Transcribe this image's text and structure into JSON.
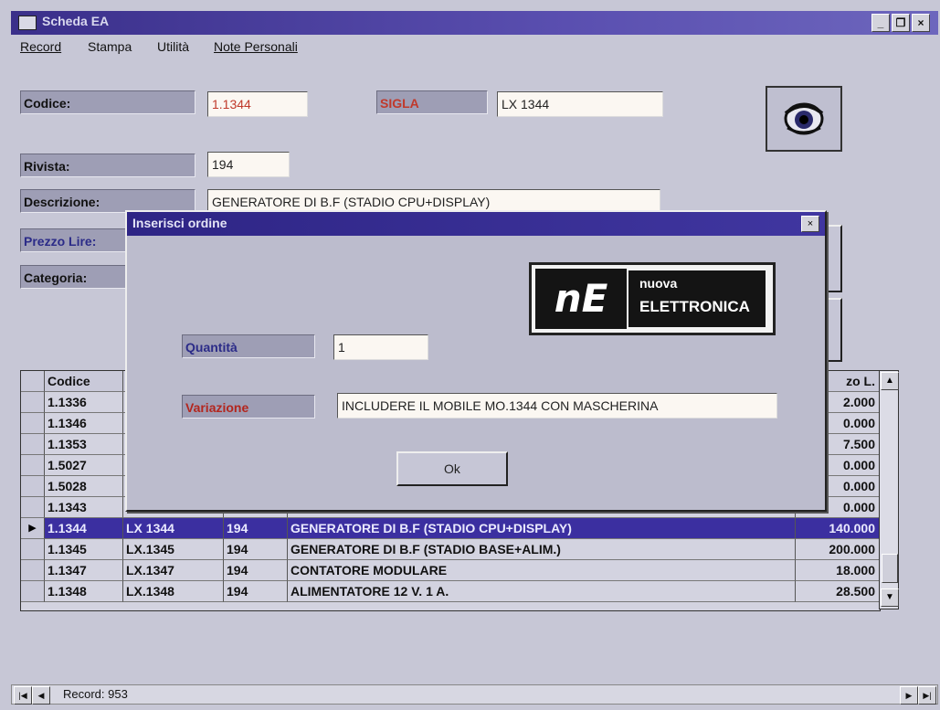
{
  "window": {
    "title": "Scheda EA",
    "min": "_",
    "max": "❐",
    "close": "×"
  },
  "menu": {
    "items": [
      {
        "label": "Record"
      },
      {
        "label": "Stampa"
      },
      {
        "label": "Utilità"
      },
      {
        "label": "Note Personali"
      }
    ]
  },
  "form": {
    "codice_label": "Codice:",
    "codice_value": "1.1344",
    "sigla_label": "SIGLA",
    "sigla_value": "LX 1344",
    "rivista_label": "Rivista:",
    "rivista_value": "194",
    "descrizione_label": "Descrizione:",
    "descrizione_value": "GENERATORE DI B.F (STADIO CPU+DISPLAY)",
    "prezzo_label": "Prezzo Lire:",
    "categoria_label": "Categoria:"
  },
  "eye_icon": "eye-icon",
  "grid": {
    "headers": [
      "Codice",
      "",
      "",
      "",
      "zo L."
    ],
    "rows": [
      {
        "codice": "1.1336",
        "sigla": "",
        "rivista": "",
        "descrizione": "",
        "prezzo": "2.000"
      },
      {
        "codice": "1.1346",
        "sigla": "",
        "rivista": "",
        "descrizione": "",
        "prezzo": "0.000"
      },
      {
        "codice": "1.1353",
        "sigla": "",
        "rivista": "",
        "descrizione": "",
        "prezzo": "7.500"
      },
      {
        "codice": "1.5027",
        "sigla": "",
        "rivista": "",
        "descrizione": "",
        "prezzo": "0.000"
      },
      {
        "codice": "1.5028",
        "sigla": "",
        "rivista": "",
        "descrizione": "",
        "prezzo": "0.000"
      },
      {
        "codice": "1.1343",
        "sigla": "",
        "rivista": "",
        "descrizione": "",
        "prezzo": "0.000"
      },
      {
        "codice": "1.1344",
        "sigla": "LX 1344",
        "rivista": "194",
        "descrizione": "GENERATORE DI B.F (STADIO CPU+DISPLAY)",
        "prezzo": "140.000",
        "selected": true
      },
      {
        "codice": "1.1345",
        "sigla": "LX.1345",
        "rivista": "194",
        "descrizione": "GENERATORE DI B.F (STADIO BASE+ALIM.)",
        "prezzo": "200.000"
      },
      {
        "codice": "1.1347",
        "sigla": "LX.1347",
        "rivista": "194",
        "descrizione": "CONTATORE MODULARE",
        "prezzo": "18.000"
      },
      {
        "codice": "1.1348",
        "sigla": "LX.1348",
        "rivista": "194",
        "descrizione": "ALIMENTATORE 12 V. 1 A.",
        "prezzo": "28.500"
      }
    ],
    "row_indicator": "▶",
    "scroll_up": "▲",
    "scroll_down": "▼"
  },
  "dialog": {
    "title": "Inserisci ordine",
    "close": "×",
    "logo_mark": "nE",
    "logo_line1": "nuova",
    "logo_line2": "ELETTRONICA",
    "quantita_label": "Quantità",
    "quantita_value": "1",
    "variazione_label": "Variazione",
    "variazione_value": "INCLUDERE IL MOBILE MO.1344 CON MASCHERINA",
    "ok_label": "Ok"
  },
  "navigator": {
    "first": "|◀",
    "prev": "◀",
    "record_text": "Record: 953",
    "next": "▶",
    "last": "▶|"
  },
  "colors": {
    "titlebar": "#3a2f8a",
    "selection": "#3b2fa0",
    "sigla_label_text": "#c0392b",
    "variazione_label_text": "#b3261e",
    "quantita_label_text": "#2b2b88"
  }
}
